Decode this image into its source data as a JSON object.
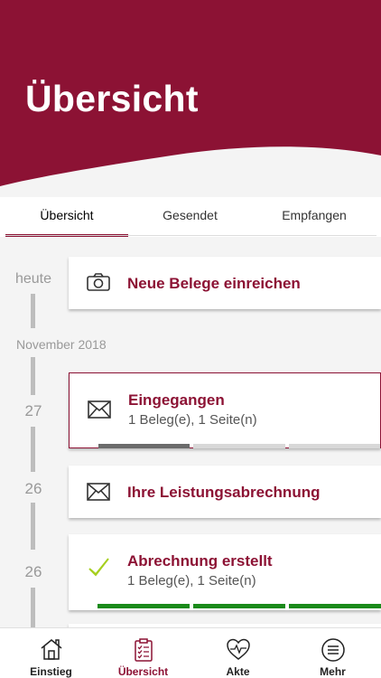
{
  "colors": {
    "brand": "#8c1234",
    "progress_gray": "#6b6b6b",
    "progress_light": "#d8d8d8",
    "progress_green": "#1a8a1a",
    "check": "#a6cf1e"
  },
  "header": {
    "title": "Übersicht"
  },
  "tabs": [
    {
      "label": "Übersicht",
      "active": true
    },
    {
      "label": "Gesendet",
      "active": false
    },
    {
      "label": "Empfangen",
      "active": false
    }
  ],
  "timeline": {
    "today_label": "heute",
    "month_label": "November 2018",
    "entries": [
      {
        "date": "",
        "icon": "camera-icon",
        "title": "Neue Belege einreichen",
        "subtitle": ""
      },
      {
        "date": "27",
        "icon": "envelope-icon",
        "title": "Eingegangen",
        "subtitle": "1 Beleg(e), 1 Seite(n)",
        "progress_steps_done": 1,
        "progress_steps_total": 3
      },
      {
        "date": "26",
        "icon": "envelope-icon",
        "title": "Ihre Leistungsabrechnung",
        "subtitle": ""
      },
      {
        "date": "26",
        "icon": "checkmark-icon",
        "title": "Abrechnung erstellt",
        "subtitle": "1 Beleg(e), 1 Seite(n)",
        "progress_steps_done": 3,
        "progress_steps_total": 3
      }
    ]
  },
  "tabbar": [
    {
      "label": "Einstieg",
      "icon": "house-icon",
      "active": false
    },
    {
      "label": "Übersicht",
      "icon": "clipboard-icon",
      "active": true
    },
    {
      "label": "Akte",
      "icon": "heart-pulse-icon",
      "active": false
    },
    {
      "label": "Mehr",
      "icon": "menu-icon",
      "active": false
    }
  ]
}
